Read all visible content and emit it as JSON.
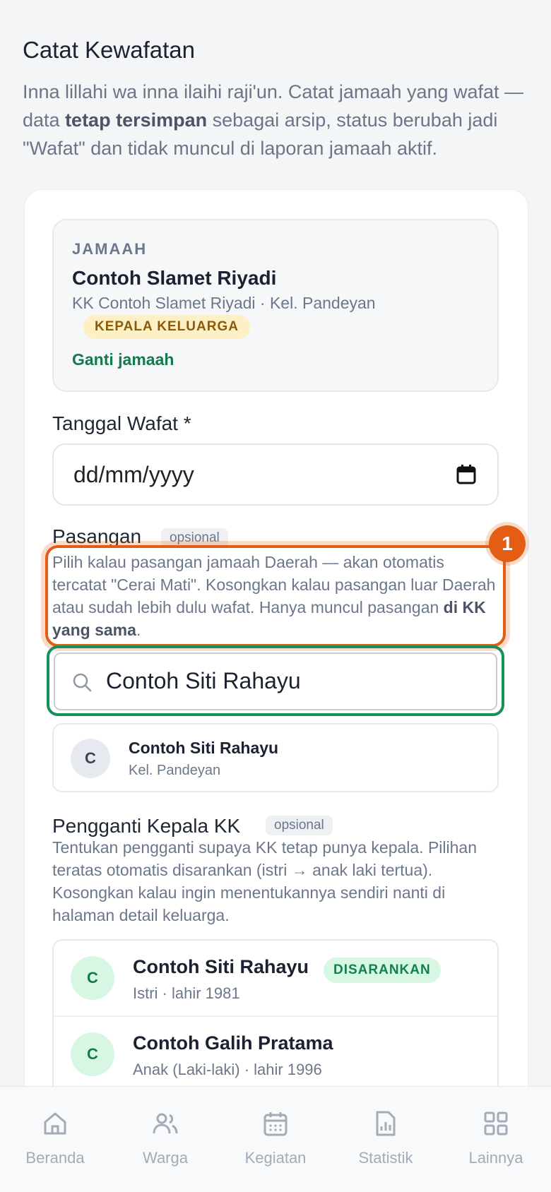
{
  "header": {
    "title": "Catat Kewafatan",
    "desc_part1": "Inna lillahi wa inna ilaihi raji'un. Catat jamaah yang wafat — data ",
    "desc_bold": "tetap tersimpan",
    "desc_part2": " sebagai arsip, status berubah jadi \"Wafat\" dan tidak muncul di laporan jamaah aktif."
  },
  "jamaah": {
    "overline": "JAMAAH",
    "name": "Contoh Slamet Riyadi",
    "subtitle": "KK Contoh Slamet Riyadi · Kel. Pandeyan",
    "badge": "KEPALA KELUARGA",
    "change_link": "Ganti jamaah"
  },
  "tanggal_wafat": {
    "label": "Tanggal Wafat *",
    "placeholder": "dd/mm/yyyy"
  },
  "pasangan": {
    "label": "Pasangan",
    "optional_tag": "opsional",
    "help_part1": "Pilih kalau pasangan jamaah Daerah — akan otomatis tercatat \"Cerai Mati\". Kosongkan kalau pasangan luar Daerah atau sudah lebih dulu wafat. Hanya muncul pasangan ",
    "help_bold": "di KK yang sama",
    "help_part2": ".",
    "search_value": "Contoh Siti Rahayu",
    "result": {
      "initial": "C",
      "name": "Contoh Siti Rahayu",
      "subtitle": "Kel. Pandeyan"
    }
  },
  "highlight": {
    "number": "1",
    "color_primary": "#e35d14",
    "color_secondary": "#17915c"
  },
  "pengganti": {
    "label": "Pengganti Kepala KK",
    "optional_tag": "opsional",
    "help": "Tentukan pengganti supaya KK tetap punya kepala. Pilihan teratas otomatis disarankan (istri → anak laki tertua). Kosongkan kalau ingin menentukannya sendiri nanti di halaman detail keluarga.",
    "candidates": [
      {
        "initial": "C",
        "name": "Contoh Siti Rahayu",
        "subtitle": "Istri · lahir 1981",
        "badge": "DISARANKAN"
      },
      {
        "initial": "C",
        "name": "Contoh Galih Pratama",
        "subtitle": "Anak (Laki-laki) · lahir 1996"
      }
    ]
  },
  "nav": {
    "items": [
      {
        "label": "Beranda",
        "icon": "home-icon"
      },
      {
        "label": "Warga",
        "icon": "users-icon"
      },
      {
        "label": "Kegiatan",
        "icon": "calendar-icon"
      },
      {
        "label": "Statistik",
        "icon": "chart-icon"
      },
      {
        "label": "Lainnya",
        "icon": "grid-icon"
      }
    ]
  }
}
